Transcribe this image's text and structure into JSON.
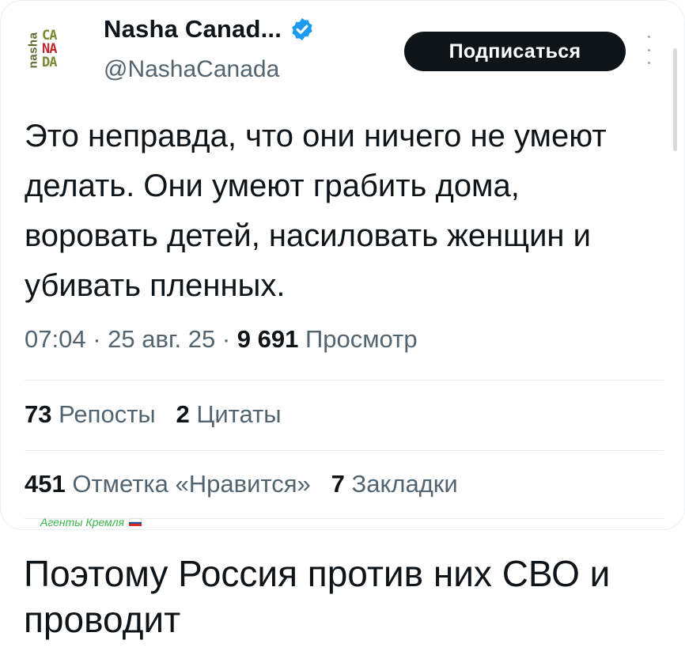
{
  "tweet": {
    "avatar": {
      "side_text": "nasha",
      "stack": [
        "CA",
        "NA",
        "DA"
      ]
    },
    "display_name": "Nasha Canad...",
    "handle": "@NashaCanada",
    "subscribe_label": "Подписаться",
    "text": "Это неправда, что они ничего не умеют делать. Они умеют грабить дома, воровать детей, насиловать женщин и убивать пленных.",
    "time": "07:04",
    "date": "25 авг. 25",
    "views_count": "9 691",
    "views_label": "Просмотр",
    "reposts_count": "73",
    "reposts_label": "Репосты",
    "quotes_count": "2",
    "quotes_label": "Цитаты",
    "likes_count": "451",
    "likes_label": "Отметка «Нравится»",
    "bookmarks_count": "7",
    "bookmarks_label": "Закладки",
    "separator": "·",
    "verified_color": "#1d9bf0"
  },
  "watermark": "Агенты Кремля",
  "caption": "Поэтому Россия против них СВО и проводит",
  "icons": [
    "verified-badge-icon",
    "more-options-icon",
    "russian-flag-icon"
  ]
}
